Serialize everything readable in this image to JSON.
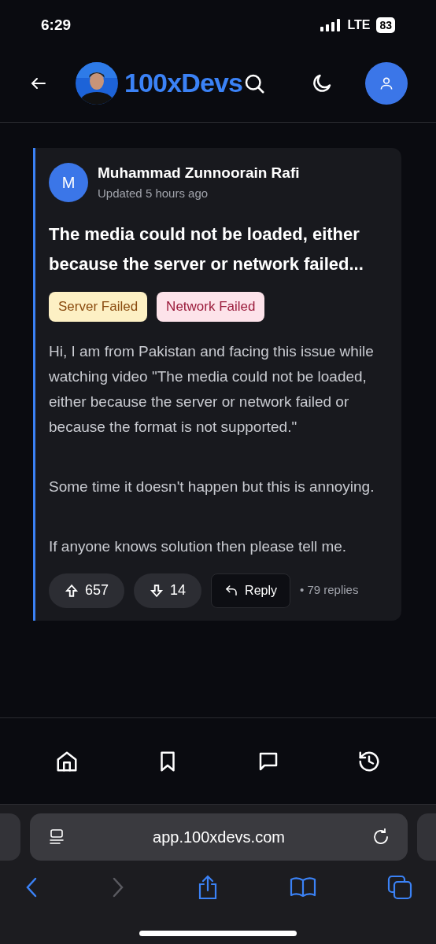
{
  "status_bar": {
    "time": "6:29",
    "network": "LTE",
    "battery": "83"
  },
  "header": {
    "brand": "100xDevs"
  },
  "post": {
    "avatar_letter": "M",
    "author": "Muhammad Zunnoorain Rafi",
    "updated": "Updated 5 hours ago",
    "title": "The media could not be loaded, either because the server or network failed...",
    "tags": [
      {
        "label": "Server Failed",
        "kind": "server"
      },
      {
        "label": "Network Failed",
        "kind": "network"
      }
    ],
    "paragraphs": [
      "Hi, I am from Pakistan and facing this issue while watching video \"The media could not be loaded, either because the server or network failed or because the format is not supported.\"",
      "Some time it doesn't happen but this is annoying.",
      "If anyone knows solution then please tell me."
    ],
    "upvotes": "657",
    "downvotes": "14",
    "reply": "Reply",
    "replies": "• 79 replies"
  },
  "bottom_nav": [
    {
      "kind": "home"
    },
    {
      "kind": "bookmark"
    },
    {
      "kind": "chat"
    },
    {
      "kind": "history"
    }
  ],
  "browser": {
    "url": "app.100xdevs.com",
    "back_disabled": false,
    "forward_disabled": true
  }
}
